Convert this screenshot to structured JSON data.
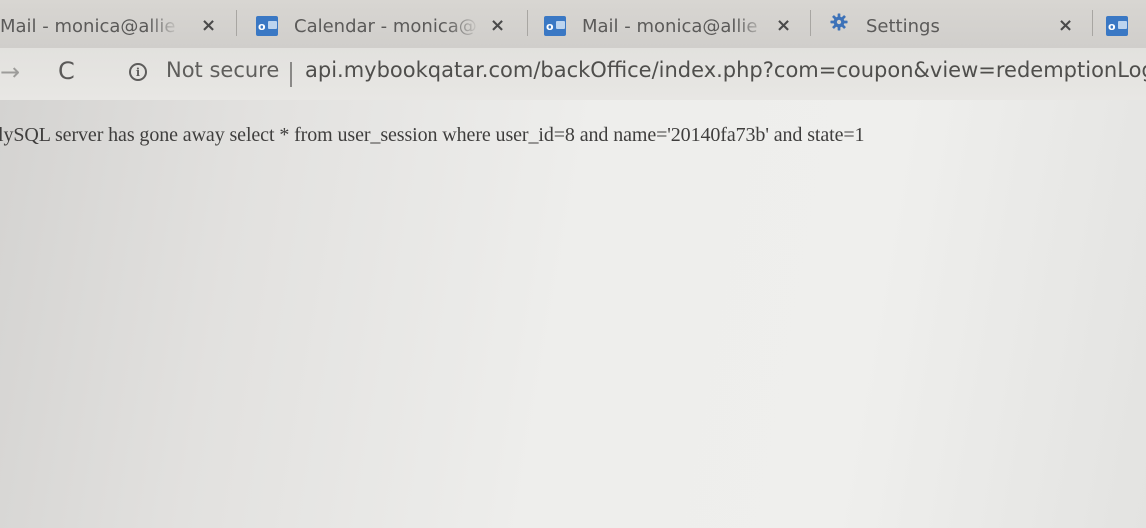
{
  "tabs": [
    {
      "label": "Mail - monica@allie",
      "close": "×",
      "icon": "outlook-icon"
    },
    {
      "label": "Calendar - monica@",
      "close": "×",
      "icon": "outlook-icon"
    },
    {
      "label": "Mail - monica@allie",
      "close": "×",
      "icon": "outlook-icon"
    },
    {
      "label": "Settings",
      "close": "×",
      "icon": "gear-icon"
    }
  ],
  "toolbar": {
    "forward_icon": "→",
    "reload_icon": "C",
    "info_icon": "i",
    "security_label": "Not secure",
    "url": "api.mybookqatar.com/backOffice/index.php?com=coupon&view=redemptionLogs"
  },
  "page": {
    "error_text": "lySQL server has gone away select * from user_session where user_id=8 and name='20140fa73b' and state=1"
  },
  "colors": {
    "tabstrip": "#d0cecb",
    "toolbar": "#e6e5e2",
    "outlook_blue": "#3a78c4",
    "text": "#3f3e3d"
  }
}
